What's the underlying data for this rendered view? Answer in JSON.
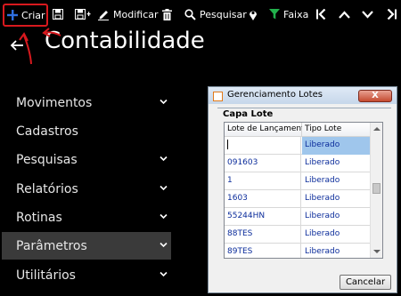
{
  "toolbar": {
    "create_label": "Criar",
    "modify_label": "Modificar",
    "search_label": "Pesquisar",
    "range_label": "Faixa"
  },
  "page": {
    "title": "Contabilidade"
  },
  "menu": {
    "items": [
      {
        "label": "Movimentos",
        "has_chevron": true
      },
      {
        "label": "Cadastros",
        "has_chevron": false
      },
      {
        "label": "Pesquisas",
        "has_chevron": true
      },
      {
        "label": "Relatórios",
        "has_chevron": true
      },
      {
        "label": "Rotinas",
        "has_chevron": true
      },
      {
        "label": "Parâmetros",
        "has_chevron": true,
        "active": true
      },
      {
        "label": "Utilitários",
        "has_chevron": true
      }
    ]
  },
  "dialog": {
    "title": "Gerenciamento Lotes",
    "close_glyph": "X",
    "group_title": "Capa Lote",
    "columns": [
      "Lote de Lançamentos",
      "Tipo Lote"
    ],
    "rows": [
      {
        "lote": "",
        "tipo": "Liberado",
        "selected": true
      },
      {
        "lote": "091603",
        "tipo": "Liberado"
      },
      {
        "lote": "1",
        "tipo": "Liberado"
      },
      {
        "lote": "1603",
        "tipo": "Liberado"
      },
      {
        "lote": "55244HN",
        "tipo": "Liberado"
      },
      {
        "lote": "88TES",
        "tipo": "Liberado"
      },
      {
        "lote": "89TES",
        "tipo": "Liberado"
      }
    ],
    "cancel_label": "Cancelar"
  },
  "colors": {
    "background": "#000000",
    "accent_blue": "#2f6fe0",
    "range_green": "#22b14c",
    "highlight_red": "#d8191e",
    "row_text": "#0b2c9b",
    "selection": "#9fc6ec"
  }
}
